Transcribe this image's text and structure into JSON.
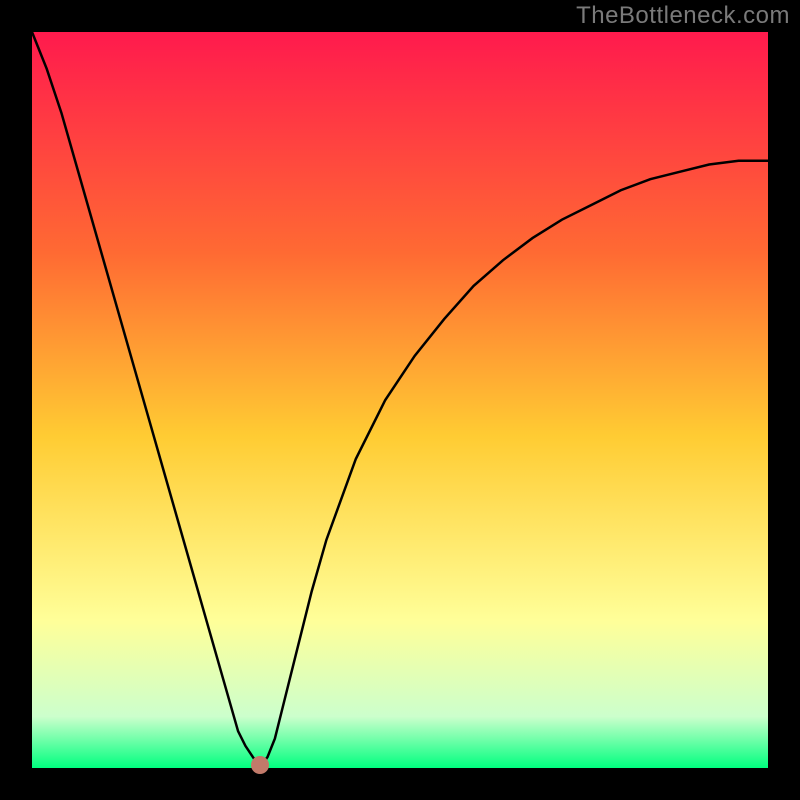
{
  "watermark": "TheBottleneck.com",
  "colors": {
    "frame": "#000000",
    "gradient_top": "#ff1a4d",
    "gradient_upper_mid": "#ff6a33",
    "gradient_mid": "#ffcc33",
    "gradient_lower_mid": "#ffff99",
    "gradient_low": "#ccffcc",
    "gradient_bottom": "#00ff7f",
    "curve": "#000000",
    "marker": "#c27a6a"
  },
  "chart_data": {
    "type": "line",
    "title": "",
    "xlabel": "",
    "ylabel": "",
    "xlim": [
      0,
      100
    ],
    "ylim": [
      0,
      100
    ],
    "x": [
      0,
      2,
      4,
      6,
      8,
      10,
      12,
      14,
      16,
      18,
      20,
      22,
      24,
      26,
      27,
      28,
      29,
      30,
      30.5,
      31,
      31.5,
      32,
      33,
      34,
      36,
      38,
      40,
      44,
      48,
      52,
      56,
      60,
      64,
      68,
      72,
      76,
      80,
      84,
      88,
      92,
      96,
      100
    ],
    "y": [
      100,
      95,
      89,
      82,
      75,
      68,
      61,
      54,
      47,
      40,
      33,
      26,
      19,
      12,
      8.5,
      5,
      3,
      1.5,
      0.8,
      0.4,
      0.8,
      1.5,
      4,
      8,
      16,
      24,
      31,
      42,
      50,
      56,
      61,
      65.5,
      69,
      72,
      74.5,
      76.5,
      78.5,
      80,
      81,
      82,
      82.5,
      82.5
    ],
    "marker": {
      "x": 31,
      "y": 0.4
    },
    "annotations": []
  }
}
